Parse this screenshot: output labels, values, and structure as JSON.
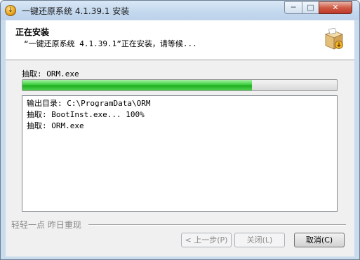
{
  "window": {
    "title": "一键还原系统 4.1.39.1 安装",
    "app_icon": "installer-disk-icon",
    "controls": {
      "minimize": "─",
      "maximize": "□",
      "close": "✕"
    }
  },
  "header": {
    "title": "正在安装",
    "subtitle": "“一键还原系统 4.1.39.1”正在安装，请等候...",
    "icon": "software-box-icon"
  },
  "status": {
    "text": "抽取: ORM.exe"
  },
  "progress": {
    "percent": 73,
    "color": "#2fc42f"
  },
  "log": {
    "lines": [
      "输出目录: C:\\ProgramData\\ORM",
      "抽取: BootInst.exe... 100%",
      "抽取: ORM.exe"
    ]
  },
  "footer": {
    "brand": "轻轻一点 昨日重现",
    "buttons": {
      "back": "< 上一步(P)",
      "close": "关闭(L)",
      "cancel": "取消(C)"
    }
  }
}
